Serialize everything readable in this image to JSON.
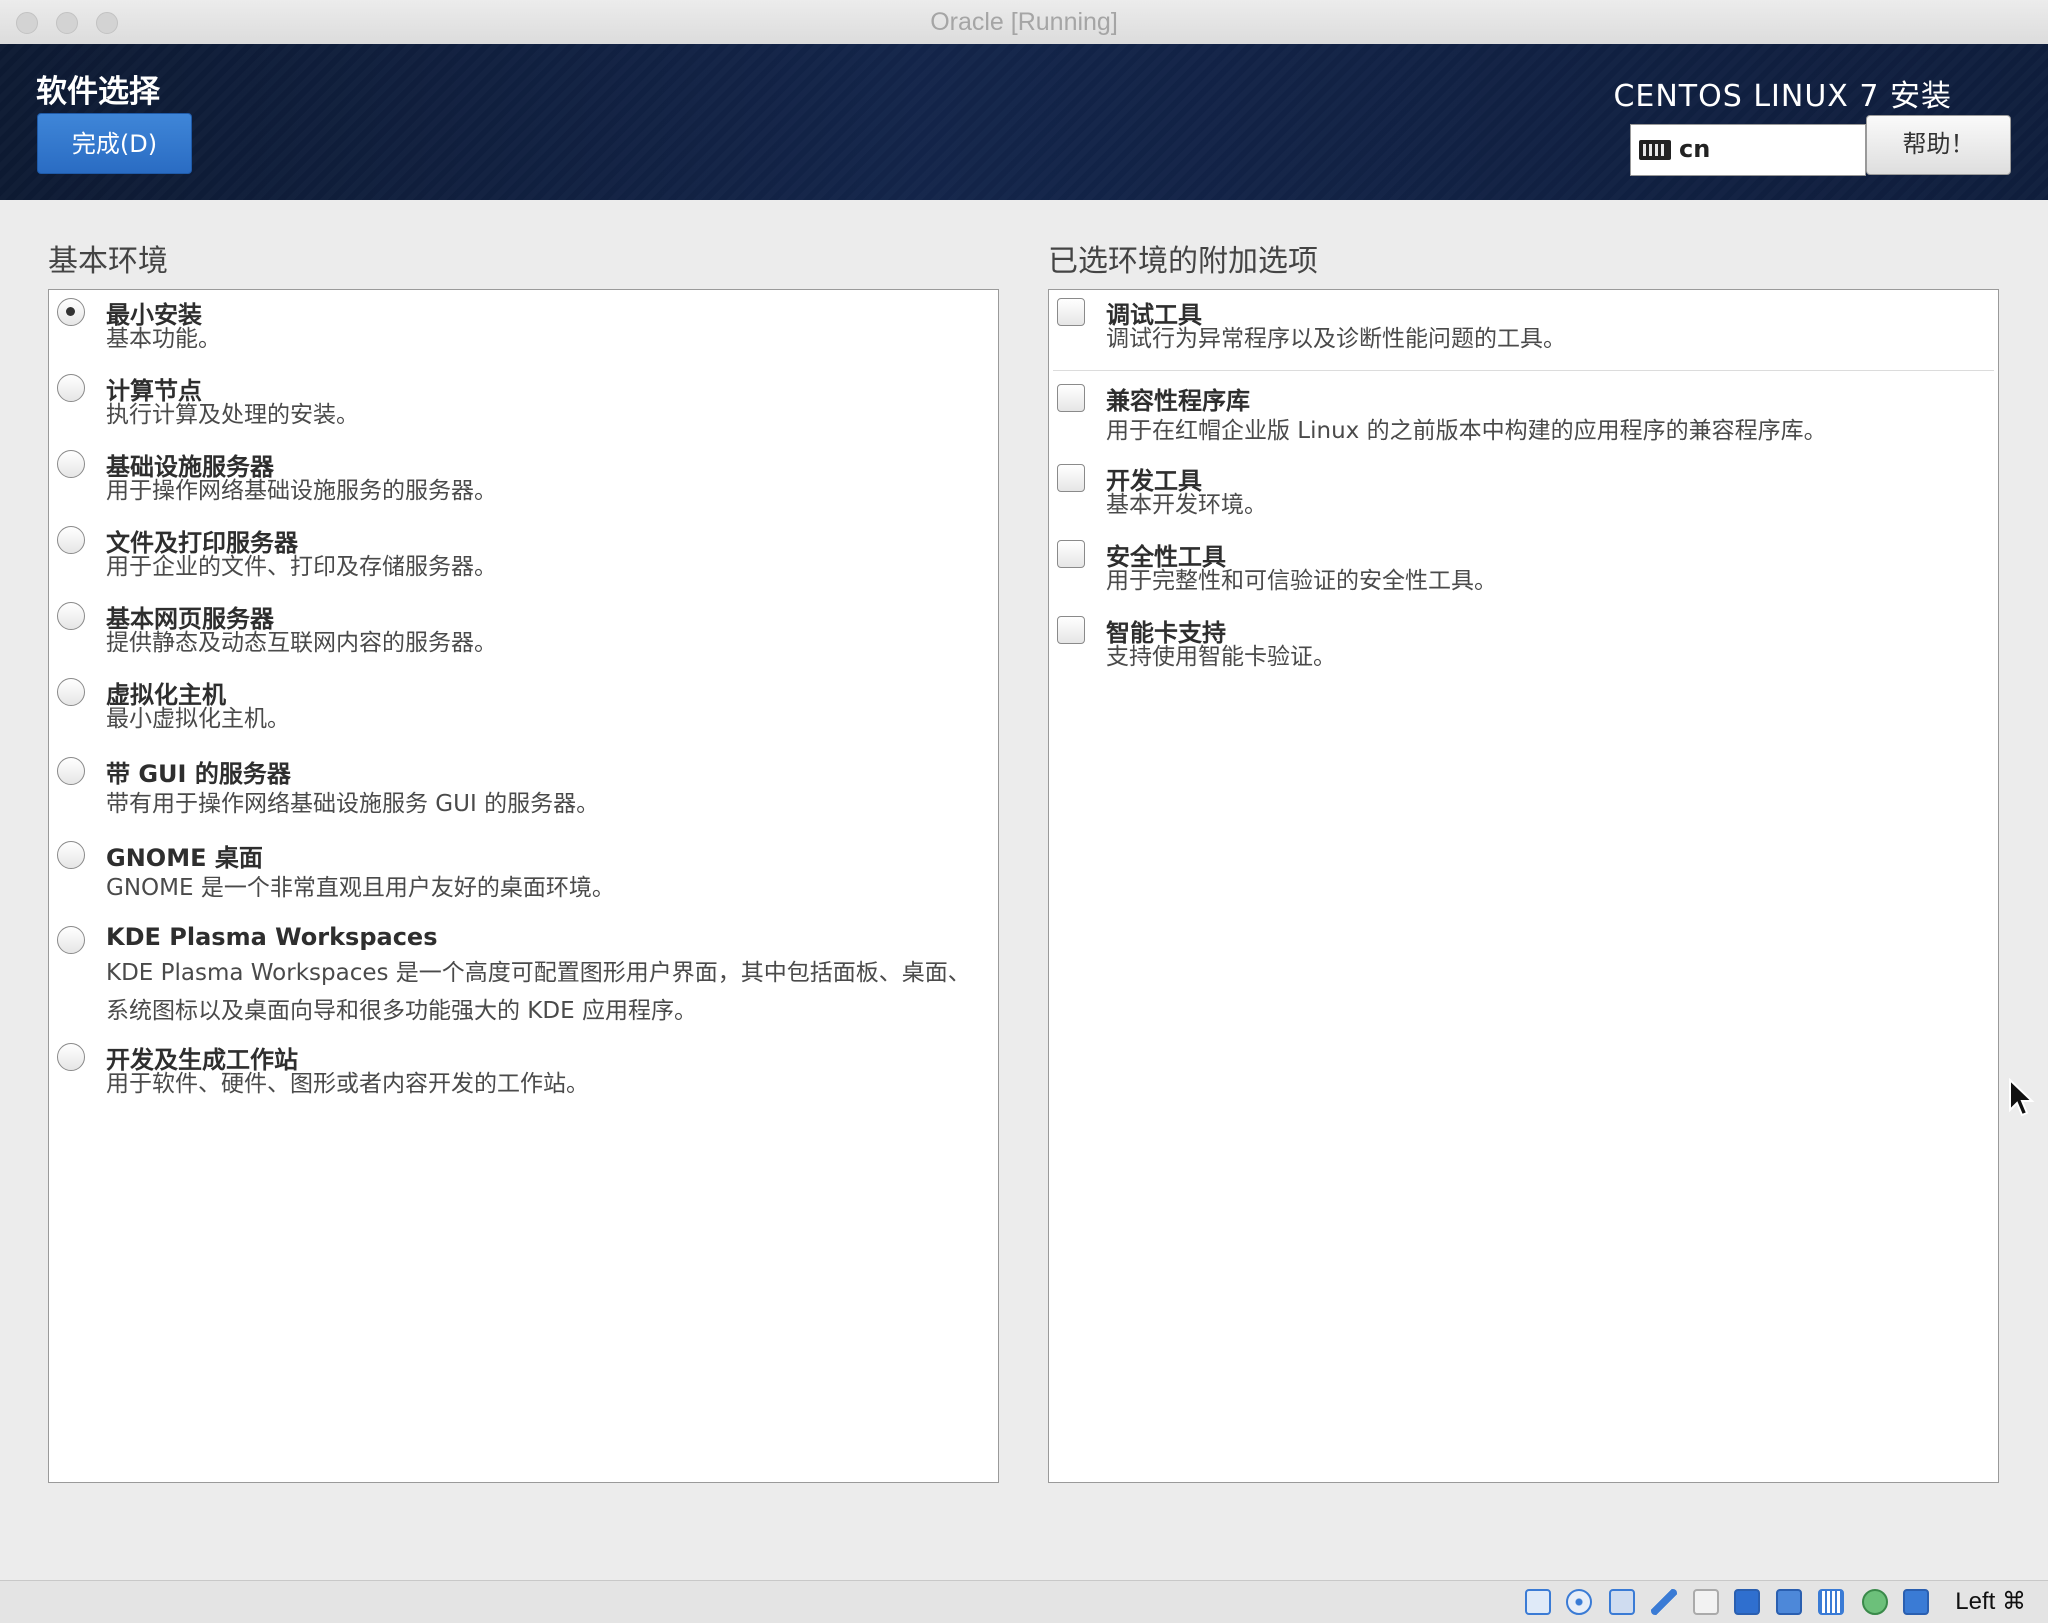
{
  "window": {
    "title": "Oracle [Running]"
  },
  "header": {
    "spoke_title": "软件选择",
    "done_label": "完成(D)",
    "product_title": "CENTOS LINUX 7 安装",
    "keyboard_layout": "cn",
    "help_label": "帮助！"
  },
  "base_environment": {
    "title": "基本环境",
    "items": [
      {
        "name": "最小安装",
        "desc": "基本功能。",
        "selected": true
      },
      {
        "name": "计算节点",
        "desc": "执行计算及处理的安装。",
        "selected": false
      },
      {
        "name": "基础设施服务器",
        "desc": "用于操作网络基础设施服务的服务器。",
        "selected": false
      },
      {
        "name": "文件及打印服务器",
        "desc": "用于企业的文件、打印及存储服务器。",
        "selected": false
      },
      {
        "name": "基本网页服务器",
        "desc": "提供静态及动态互联网内容的服务器。",
        "selected": false
      },
      {
        "name": "虚拟化主机",
        "desc": "最小虚拟化主机。",
        "selected": false
      },
      {
        "name": "带 GUI 的服务器",
        "desc": "带有用于操作网络基础设施服务 GUI 的服务器。",
        "selected": false
      },
      {
        "name": "GNOME 桌面",
        "desc": "GNOME 是一个非常直观且用户友好的桌面环境。",
        "selected": false
      },
      {
        "name": "KDE Plasma Workspaces",
        "desc": "KDE Plasma Workspaces 是一个高度可配置图形用户界面，其中包括面板、桌面、系统图标以及桌面向导和很多功能强大的 KDE 应用程序。",
        "selected": false
      },
      {
        "name": "开发及生成工作站",
        "desc": "用于软件、硬件、图形或者内容开发的工作站。",
        "selected": false
      }
    ]
  },
  "addons": {
    "title": "已选环境的附加选项",
    "items": [
      {
        "name": "调试工具",
        "desc": "调试行为异常程序以及诊断性能问题的工具。",
        "checked": false
      },
      {
        "name": "兼容性程序库",
        "desc": "用于在红帽企业版 Linux 的之前版本中构建的应用程序的兼容程序库。",
        "checked": false
      },
      {
        "name": "开发工具",
        "desc": "基本开发环境。",
        "checked": false
      },
      {
        "name": "安全性工具",
        "desc": "用于完整性和可信验证的安全性工具。",
        "checked": false
      },
      {
        "name": "智能卡支持",
        "desc": "支持使用智能卡验证。",
        "checked": false
      }
    ]
  },
  "statusbar": {
    "host_key": "Left ⌘",
    "icons": [
      "hard-disk-icon",
      "optical-drive-icon",
      "audio-icon",
      "usb-icon",
      "shared-folder-icon",
      "display-icon",
      "network-icon",
      "cpu-icon",
      "recording-icon",
      "download-icon"
    ]
  },
  "colors": {
    "header_bg": "#13254a",
    "done_button": "#3377cc",
    "background": "#ececec"
  }
}
